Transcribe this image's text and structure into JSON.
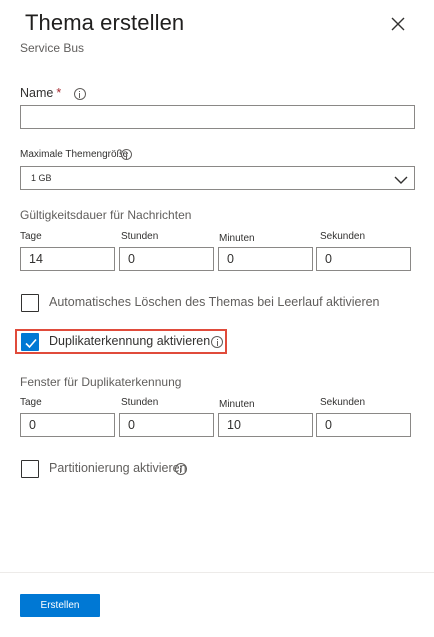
{
  "header": {
    "title": "Thema erstellen",
    "subtitle": "Service Bus"
  },
  "name_field": {
    "label": "Name",
    "required_marker": "*",
    "value": ""
  },
  "max_size": {
    "label": "Maximale Themengröße",
    "selected": "1 GB"
  },
  "ttl": {
    "label": "Gültigkeitsdauer für Nachrichten",
    "days_label": "Tage",
    "days_value": "14",
    "hours_label": "Stunden",
    "hours_value": "0",
    "minutes_label": "Minuten",
    "minutes_value": "0",
    "seconds_label": "Sekunden",
    "seconds_value": "0"
  },
  "auto_delete": {
    "label": "Automatisches Löschen des Themas bei Leerlauf aktivieren",
    "checked": false
  },
  "duplicate_detection": {
    "label": "Duplikaterkennung aktivieren",
    "checked": true,
    "highlight_color": "#e04b3b"
  },
  "dup_window": {
    "label": "Fenster für Duplikaterkennung",
    "days_label": "Tage",
    "days_value": "0",
    "hours_label": "Stunden",
    "hours_value": "0",
    "minutes_label": "Minuten",
    "minutes_value": "10",
    "seconds_label": "Sekunden",
    "seconds_value": "0"
  },
  "partitioning": {
    "label": "Partitionierung aktivieren",
    "checked": false
  },
  "footer": {
    "create_label": "Erstellen"
  },
  "colors": {
    "accent": "#0078d4",
    "required": "#a4262c"
  },
  "icons": {
    "close": "close-icon",
    "info": "info-icon",
    "chevron": "chevron-down-icon",
    "check": "checkmark-icon"
  }
}
